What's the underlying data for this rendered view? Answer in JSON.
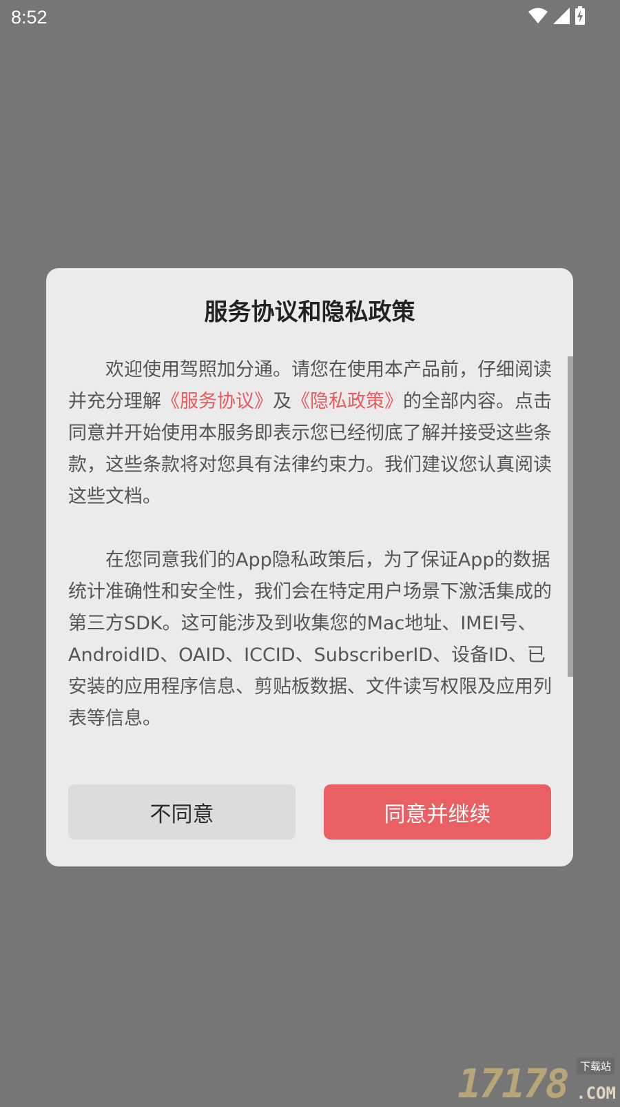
{
  "status_bar": {
    "time": "8:52",
    "icons": [
      "wifi-icon",
      "cellular-signal-icon",
      "battery-charging-icon"
    ]
  },
  "dialog": {
    "title": "服务协议和隐私政策",
    "paragraph1": {
      "text_before": "欢迎使用驾照加分通。请您在使用本产品前，仔细阅读并充分理解",
      "link_service": "《服务协议》",
      "text_mid": "及",
      "link_privacy": "《隐私政策》",
      "text_after": "的全部内容。点击同意并开始使用本服务即表示您已经彻底了解并接受这些条款，这些条款将对您具有法律约束力。我们建议您认真阅读这些文档。"
    },
    "paragraph2": "在您同意我们的App隐私政策后，为了保证App的数据统计准确性和安全性，我们会在特定用户场景下激活集成的第三方SDK。这可能涉及到收集您的Mac地址、IMEI号、AndroidID、OAID、ICCID、SubscriberID、设备ID、已安装的应用程序信息、剪贴板数据、文件读写权限及应用列表等信息。",
    "disagree_label": "不同意",
    "agree_label": "同意并继续"
  },
  "watermark": {
    "digits": "17178",
    "suffix": ".COM",
    "badge": "下载站"
  },
  "colors": {
    "overlay": "#767676",
    "dialog_bg": "#ebebeb",
    "link": "#e85b5e",
    "agree_button": "#ea5f64",
    "disagree_button": "#dcdcdc"
  }
}
